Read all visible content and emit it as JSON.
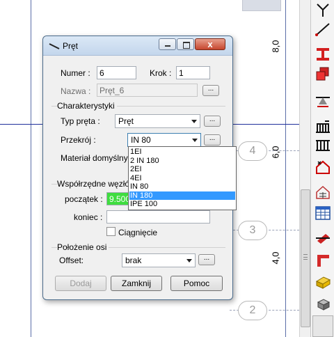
{
  "canvas": {
    "axis_labels": [
      "8,0",
      "6,0",
      "4,0"
    ],
    "node_labels": [
      "4",
      "3",
      "2"
    ]
  },
  "dialog": {
    "title": "Pręt",
    "close_glyph": "x",
    "numer_label": "Numer :",
    "numer_value": "6",
    "krok_label": "Krok :",
    "krok_value": "1",
    "nazwa_label": "Nazwa :",
    "nazwa_value": "Pręt_6",
    "browse_glyph": "...",
    "charakterystyki": {
      "title": "Charakterystyki",
      "typ_label": "Typ pręta :",
      "typ_value": "Pręt",
      "przekroj_label": "Przekrój :",
      "przekroj_value": "IN 80",
      "material_label": "Materiał domyślny:",
      "przekroj_options": [
        "1EI",
        "2 IN 180",
        "2EI",
        "4EI",
        "IN 80",
        "IN 180",
        "IPE 100"
      ],
      "highlighted_option": "IN 180"
    },
    "wspolrzedne": {
      "title": "Współrzędne węzłó",
      "poczatek_label": "początek :",
      "poczatek_value": "9.500",
      "koniec_label": "koniec :",
      "koniec_value": "",
      "ciagniecie_label": "Ciągnięcie",
      "ciagniecie_checked": false
    },
    "polozenie": {
      "title": "Położenie osi",
      "offset_label": "Offset:",
      "offset_value": "brak"
    },
    "buttons": {
      "dodaj": "Dodaj",
      "zamknij": "Zamknij",
      "pomoc": "Pomoc"
    }
  },
  "toolbar": {
    "tools": [
      "fork-tool-icon",
      "line-tool-icon",
      "i-beam-icon",
      "section-icon",
      "support-icon",
      "release-icon",
      "truss-icon",
      "load-icon",
      "table-grid-icon",
      "table-icon",
      "pipe-icon",
      "angle-icon",
      "plate-icon",
      "solid-icon"
    ]
  }
}
